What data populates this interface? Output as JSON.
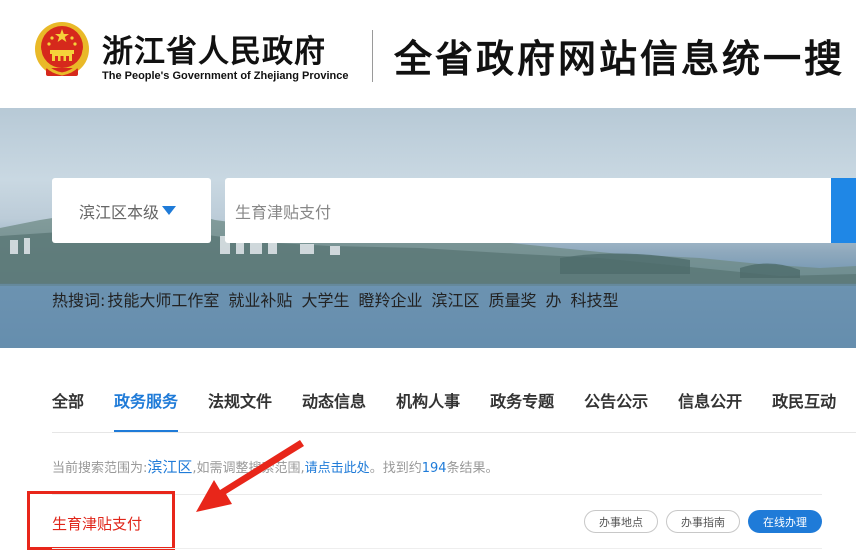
{
  "header": {
    "gov_name": "浙江省人民政府",
    "gov_name_en": "The People's Government of Zhejiang Province",
    "site_title": "全省政府网站信息统一搜"
  },
  "search": {
    "scope": "滨江区本级",
    "query": "生育津贴支付",
    "placeholder": "生育津贴支付"
  },
  "hot_search": {
    "label": "热搜词:",
    "keywords": [
      "技能大师工作室",
      "就业补贴",
      "大学生",
      "瞪羚企业",
      "滨江区",
      "质量奖",
      "办",
      "科技型"
    ]
  },
  "tabs": [
    {
      "label": "全部",
      "active": false
    },
    {
      "label": "政务服务",
      "active": true
    },
    {
      "label": "法规文件",
      "active": false
    },
    {
      "label": "动态信息",
      "active": false
    },
    {
      "label": "机构人事",
      "active": false
    },
    {
      "label": "政务专题",
      "active": false
    },
    {
      "label": "公告公示",
      "active": false
    },
    {
      "label": "信息公开",
      "active": false
    },
    {
      "label": "政民互动",
      "active": false
    }
  ],
  "scope_info": {
    "prefix": "当前搜索范围为:",
    "region": "滨江区",
    "middle": ",如需调整搜索范围,",
    "link": "请点击此处",
    "after_link": "。找到约",
    "count": "194",
    "suffix": "条结果。"
  },
  "result": {
    "title": "生育津贴支付",
    "buttons": {
      "location": "办事地点",
      "guide": "办事指南",
      "online": "在线办理"
    }
  },
  "colors": {
    "accent": "#1f7bd8",
    "highlight_red": "#e0261a",
    "annotation_red": "#e8261a"
  }
}
